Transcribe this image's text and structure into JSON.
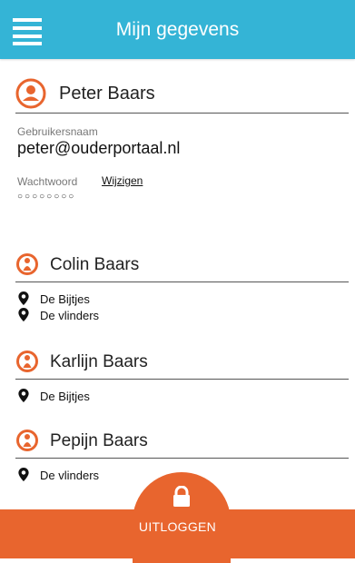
{
  "header": {
    "title": "Mijn gegevens",
    "menu_icon": "hamburger-menu-icon"
  },
  "profile": {
    "name": "Peter Baars",
    "avatar_icon": "person-icon",
    "username_label": "Gebruikersnaam",
    "username": "peter@ouderportaal.nl",
    "password_label": "Wachtwoord",
    "change_link": "Wijzigen",
    "password_mask": "○○○○○○○○"
  },
  "children": [
    {
      "name": "Colin Baars",
      "groups": [
        "De Bijtjes",
        "De vlinders"
      ]
    },
    {
      "name": "Karlijn Baars",
      "groups": [
        "De Bijtjes"
      ]
    },
    {
      "name": "Pepijn Baars",
      "groups": [
        "De vlinders"
      ]
    }
  ],
  "footer": {
    "logout_label": "UITLOGGEN",
    "lock_icon": "lock-icon"
  },
  "colors": {
    "header": "#34b4d6",
    "accent": "#e8652e"
  }
}
